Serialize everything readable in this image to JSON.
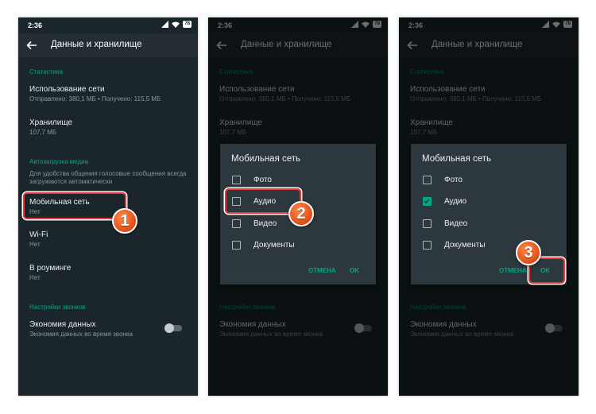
{
  "status": {
    "time": "2:36",
    "battery": "78"
  },
  "appbar": {
    "title": "Данные и хранилище"
  },
  "sections": {
    "stats": "Статистика",
    "media": "Автозагрузка медиа",
    "calls": "Настройки звонков"
  },
  "items": {
    "network": {
      "title": "Использование сети",
      "sub": "Отправлено: 380,1 МБ • Получено: 115,5 МБ"
    },
    "storage": {
      "title": "Хранилище",
      "sub": "107,7 МБ"
    },
    "media_desc": "Для удобства общения голосовые сообщения всегда загружаются автоматически",
    "mobile": {
      "title": "Мобильная сеть",
      "sub": "Нет"
    },
    "wifi": {
      "title": "Wi-Fi",
      "sub": "Нет"
    },
    "roaming": {
      "title": "В роуминге",
      "sub": "Нет"
    },
    "economy": {
      "title": "Экономия данных",
      "sub": "Экономия данных во время звонка"
    }
  },
  "dialog": {
    "title": "Мобильная сеть",
    "options": [
      "Фото",
      "Аудио",
      "Видео",
      "Документы"
    ],
    "cancel": "ОТМЕНА",
    "ok": "OK",
    "panel2_checked": [
      false,
      false,
      false,
      false
    ],
    "panel3_checked": [
      false,
      true,
      false,
      false
    ]
  },
  "markers": [
    "1",
    "2",
    "3"
  ],
  "colors": {
    "background": "#1b262c",
    "accent": "#00a884",
    "highlight": "#e53935",
    "marker": "#e5501a"
  }
}
